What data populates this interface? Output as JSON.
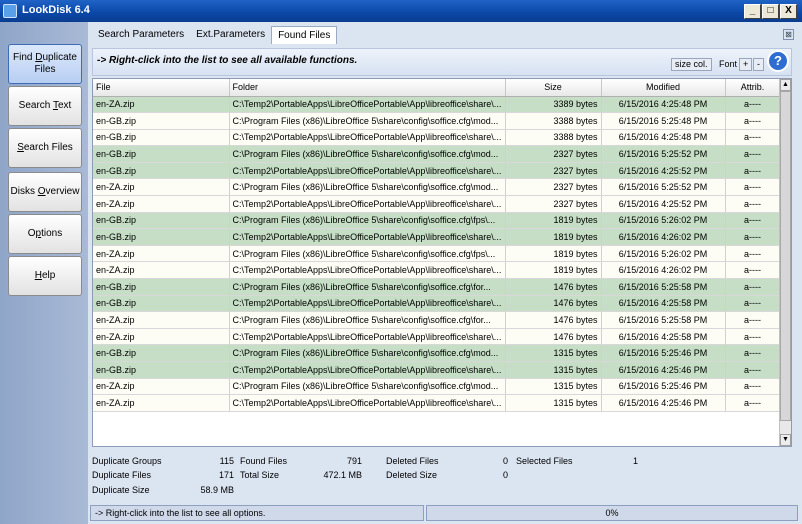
{
  "window": {
    "title": "LookDisk 6.4",
    "minimize": "_",
    "maximize": "□",
    "close": "X"
  },
  "sidebar": {
    "items": [
      {
        "pre": "Find ",
        "ul": "D",
        "post": "uplicate Files",
        "active": true
      },
      {
        "pre": "Search ",
        "ul": "T",
        "post": "ext",
        "active": false
      },
      {
        "pre": "",
        "ul": "S",
        "post": "earch Files",
        "active": false
      },
      {
        "pre": "Disks ",
        "ul": "O",
        "post": "verview",
        "active": false
      },
      {
        "pre": "O",
        "ul": "p",
        "post": "tions",
        "active": false
      },
      {
        "pre": "",
        "ul": "H",
        "post": "elp",
        "active": false
      }
    ]
  },
  "tabs": [
    "Search Parameters",
    "Ext.Parameters",
    "Found Files"
  ],
  "active_tab": 2,
  "hint": "-> Right-click into the list to see all available functions.",
  "toolbar": {
    "size_col": "size col.",
    "font": "Font",
    "plus": "+",
    "minus": "-",
    "help": "?"
  },
  "table": {
    "headers": [
      "File",
      "Folder",
      "Size",
      "Modified",
      "Attrib."
    ],
    "rows": [
      {
        "g": true,
        "file": "en-ZA.zip",
        "folder": "C:\\Temp2\\PortableApps\\LibreOfficePortable\\App\\libreoffice\\share\\...",
        "size": "3389 bytes",
        "mod": "6/15/2016 4:25:48 PM",
        "attr": "a----"
      },
      {
        "g": false,
        "file": "en-GB.zip",
        "folder": "C:\\Program Files (x86)\\LibreOffice 5\\share\\config\\soffice.cfg\\mod...",
        "size": "3388 bytes",
        "mod": "6/15/2016 5:25:48 PM",
        "attr": "a----"
      },
      {
        "g": false,
        "file": "en-GB.zip",
        "folder": "C:\\Temp2\\PortableApps\\LibreOfficePortable\\App\\libreoffice\\share\\...",
        "size": "3388 bytes",
        "mod": "6/15/2016 4:25:48 PM",
        "attr": "a----"
      },
      {
        "g": true,
        "file": "en-GB.zip",
        "folder": "C:\\Program Files (x86)\\LibreOffice 5\\share\\config\\soffice.cfg\\mod...",
        "size": "2327 bytes",
        "mod": "6/15/2016 5:25:52 PM",
        "attr": "a----"
      },
      {
        "g": true,
        "file": "en-GB.zip",
        "folder": "C:\\Temp2\\PortableApps\\LibreOfficePortable\\App\\libreoffice\\share\\...",
        "size": "2327 bytes",
        "mod": "6/15/2016 4:25:52 PM",
        "attr": "a----"
      },
      {
        "g": false,
        "file": "en-ZA.zip",
        "folder": "C:\\Program Files (x86)\\LibreOffice 5\\share\\config\\soffice.cfg\\mod...",
        "size": "2327 bytes",
        "mod": "6/15/2016 5:25:52 PM",
        "attr": "a----"
      },
      {
        "g": false,
        "file": "en-ZA.zip",
        "folder": "C:\\Temp2\\PortableApps\\LibreOfficePortable\\App\\libreoffice\\share\\...",
        "size": "2327 bytes",
        "mod": "6/15/2016 4:25:52 PM",
        "attr": "a----"
      },
      {
        "g": true,
        "file": "en-GB.zip",
        "folder": "C:\\Program Files (x86)\\LibreOffice 5\\share\\config\\soffice.cfg\\fps\\...",
        "size": "1819 bytes",
        "mod": "6/15/2016 5:26:02 PM",
        "attr": "a----"
      },
      {
        "g": true,
        "file": "en-GB.zip",
        "folder": "C:\\Temp2\\PortableApps\\LibreOfficePortable\\App\\libreoffice\\share\\...",
        "size": "1819 bytes",
        "mod": "6/15/2016 4:26:02 PM",
        "attr": "a----"
      },
      {
        "g": false,
        "file": "en-ZA.zip",
        "folder": "C:\\Program Files (x86)\\LibreOffice 5\\share\\config\\soffice.cfg\\fps\\...",
        "size": "1819 bytes",
        "mod": "6/15/2016 5:26:02 PM",
        "attr": "a----"
      },
      {
        "g": false,
        "file": "en-ZA.zip",
        "folder": "C:\\Temp2\\PortableApps\\LibreOfficePortable\\App\\libreoffice\\share\\...",
        "size": "1819 bytes",
        "mod": "6/15/2016 4:26:02 PM",
        "attr": "a----"
      },
      {
        "g": true,
        "file": "en-GB.zip",
        "folder": "C:\\Program Files (x86)\\LibreOffice 5\\share\\config\\soffice.cfg\\for...",
        "size": "1476 bytes",
        "mod": "6/15/2016 5:25:58 PM",
        "attr": "a----"
      },
      {
        "g": true,
        "file": "en-GB.zip",
        "folder": "C:\\Temp2\\PortableApps\\LibreOfficePortable\\App\\libreoffice\\share\\...",
        "size": "1476 bytes",
        "mod": "6/15/2016 4:25:58 PM",
        "attr": "a----"
      },
      {
        "g": false,
        "file": "en-ZA.zip",
        "folder": "C:\\Program Files (x86)\\LibreOffice 5\\share\\config\\soffice.cfg\\for...",
        "size": "1476 bytes",
        "mod": "6/15/2016 5:25:58 PM",
        "attr": "a----"
      },
      {
        "g": false,
        "file": "en-ZA.zip",
        "folder": "C:\\Temp2\\PortableApps\\LibreOfficePortable\\App\\libreoffice\\share\\...",
        "size": "1476 bytes",
        "mod": "6/15/2016 4:25:58 PM",
        "attr": "a----"
      },
      {
        "g": true,
        "file": "en-GB.zip",
        "folder": "C:\\Program Files (x86)\\LibreOffice 5\\share\\config\\soffice.cfg\\mod...",
        "size": "1315 bytes",
        "mod": "6/15/2016 5:25:46 PM",
        "attr": "a----"
      },
      {
        "g": true,
        "file": "en-GB.zip",
        "folder": "C:\\Temp2\\PortableApps\\LibreOfficePortable\\App\\libreoffice\\share\\...",
        "size": "1315 bytes",
        "mod": "6/15/2016 4:25:46 PM",
        "attr": "a----"
      },
      {
        "g": false,
        "file": "en-ZA.zip",
        "folder": "C:\\Program Files (x86)\\LibreOffice 5\\share\\config\\soffice.cfg\\mod...",
        "size": "1315 bytes",
        "mod": "6/15/2016 5:25:46 PM",
        "attr": "a----"
      },
      {
        "g": false,
        "file": "en-ZA.zip",
        "folder": "C:\\Temp2\\PortableApps\\LibreOfficePortable\\App\\libreoffice\\share\\...",
        "size": "1315 bytes",
        "mod": "6/15/2016 4:25:46 PM",
        "attr": "a----"
      }
    ]
  },
  "stats": {
    "duplicate_groups_label": "Duplicate Groups",
    "duplicate_groups": "115",
    "duplicate_files_label": "Duplicate Files",
    "duplicate_files": "171",
    "duplicate_size_label": "Duplicate Size",
    "duplicate_size": "58.9 MB",
    "found_files_label": "Found Files",
    "found_files": "791",
    "total_size_label": "Total Size",
    "total_size": "472.1 MB",
    "deleted_files_label": "Deleted Files",
    "deleted_files": "0",
    "deleted_size_label": "Deleted Size",
    "deleted_size": "0",
    "selected_files_label": "Selected Files",
    "selected_files": "1"
  },
  "status": {
    "text": "-> Right-click into the list to see all options.",
    "progress_label": "0%",
    "progress": 0
  }
}
